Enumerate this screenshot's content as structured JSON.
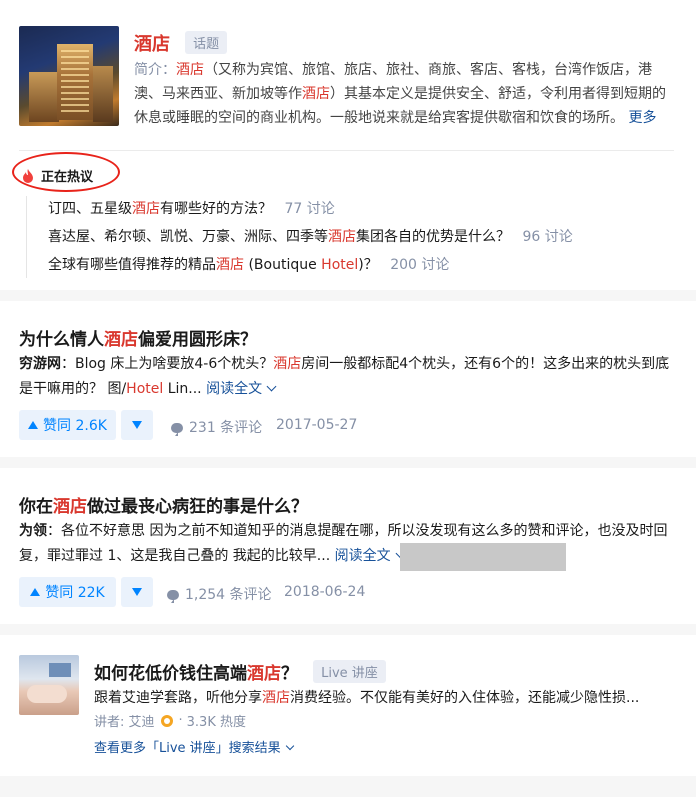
{
  "topic": {
    "name": "酒店",
    "badge": "话题",
    "intro_label": "简介：",
    "intro_hl1": "酒店",
    "intro_text1": "（又称为宾馆、旅馆、旅店、旅社、商旅、客店、客栈，台湾作饭店，港",
    "intro_text2": "澳、马来西亚、新加坡等作",
    "intro_hl2": "酒店",
    "intro_text3": "）其基本定义是提供安全、舒适，令利用者得到短期的",
    "intro_text4": "休息或睡眠的空间的商业机构。一般地说来就是给宾客提供歇宿和饮食的场所。",
    "more": "更多"
  },
  "hot": {
    "title": "正在热议",
    "items": [
      {
        "pre": "订四、五星级",
        "hl": "酒店",
        "post": "有哪些好的方法？",
        "count": "77 讨论"
      },
      {
        "pre": "喜达屋、希尔顿、凯悦、万豪、洲际、四季等",
        "hl": "酒店",
        "post": "集团各自的优势是什么？",
        "count": "96 讨论"
      },
      {
        "pre": "全球有哪些值得推荐的精品",
        "hl": "酒店",
        "mid": " (Boutique ",
        "hl2": "Hotel",
        "post": ")？",
        "count": "200 讨论"
      }
    ]
  },
  "answers": [
    {
      "title_pre": "为什么情人",
      "title_hl": "酒店",
      "title_post": "偏爱用圆形床？",
      "author": "穷游网",
      "line1_pre": "：Blog 床上为啥要放4-6个枕头？",
      "line1_hl": "酒店",
      "line1_post": "房间一般都标配4个枕头，还有6个的！这多出来的枕头到底",
      "line2_pre": "是干嘛用的？ 图/",
      "line2_hl": "Hotel",
      "line2_post": " Lin...",
      "read_more": "阅读全文",
      "vote": "赞同 2.6K",
      "comments": "231 条评论",
      "date": "2017-05-27"
    },
    {
      "title_pre": "你在",
      "title_hl": "酒店",
      "title_post": "做过最丧心病狂的事是什么？",
      "author": "为领",
      "line1": "：各位不好意思 因为之前不知道知乎的消息提醒在哪，所以没发现有这么多的赞和评论，也没及时回",
      "line2": "复，罪过罪过 1、这是我自己叠的 我起的比较早...",
      "read_more": "阅读全文",
      "vote": "赞同 22K",
      "comments": "1,254 条评论",
      "date": "2018-06-24"
    }
  ],
  "live": {
    "title_pre": "如何花低价钱住高端",
    "title_hl": "酒店",
    "title_post": "？",
    "badge": "Live 讲座",
    "desc_pre": "跟着艾迪学套路，听他分享",
    "desc_hl": "酒店",
    "desc_post": "消费经验。不仅能有美好的入住体验，还能减少隐性损...",
    "speaker_label": "讲者: 艾迪",
    "heat": "3.3K 热度",
    "see_more": "查看更多「Live 讲座」搜索结果"
  },
  "colors": {
    "highlight": "#d9382e",
    "primary": "#0084ff",
    "link": "#175199",
    "muted": "#8590a6"
  }
}
